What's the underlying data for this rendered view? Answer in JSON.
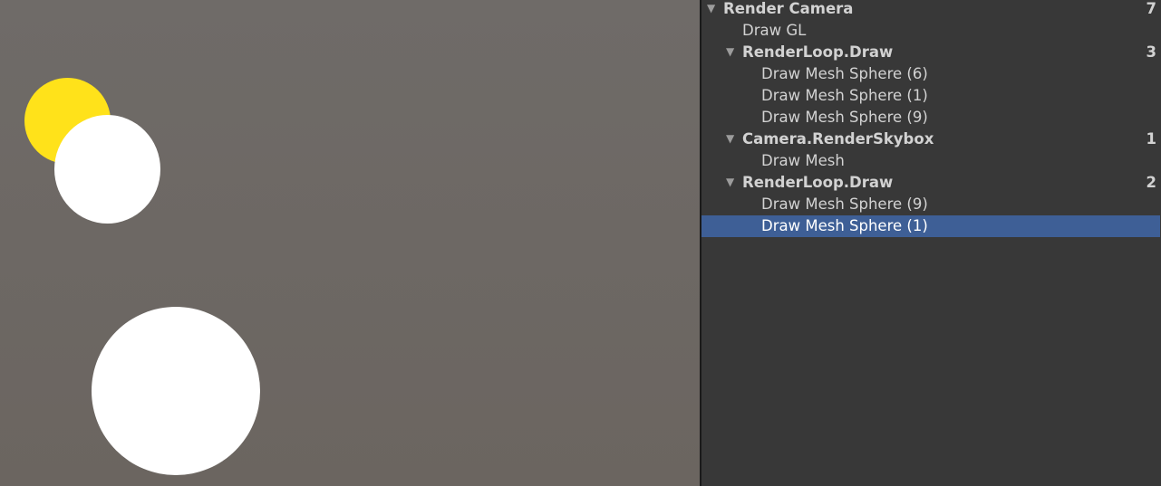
{
  "scene": {
    "colors": {
      "background": "#6d6863",
      "yellow_sphere": "#ffe21a",
      "white_sphere": "#ffffff"
    }
  },
  "frame_debugger": {
    "selected_color": "#3e5f96",
    "tree": [
      {
        "label": "Render Camera",
        "count": "7",
        "bold": true,
        "expanded": true
      },
      {
        "label": "Draw GL",
        "count": "",
        "bold": false
      },
      {
        "label": "RenderLoop.Draw",
        "count": "3",
        "bold": true,
        "expanded": true
      },
      {
        "label": "Draw Mesh Sphere (6)",
        "count": "",
        "bold": false
      },
      {
        "label": "Draw Mesh Sphere (1)",
        "count": "",
        "bold": false
      },
      {
        "label": "Draw Mesh Sphere (9)",
        "count": "",
        "bold": false
      },
      {
        "label": "Camera.RenderSkybox",
        "count": "1",
        "bold": true,
        "expanded": true
      },
      {
        "label": "Draw Mesh",
        "count": "",
        "bold": false
      },
      {
        "label": "RenderLoop.Draw",
        "count": "2",
        "bold": true,
        "expanded": true
      },
      {
        "label": "Draw Mesh Sphere (9)",
        "count": "",
        "bold": false
      },
      {
        "label": "Draw Mesh Sphere (1)",
        "count": "",
        "bold": false,
        "selected": true
      }
    ]
  }
}
